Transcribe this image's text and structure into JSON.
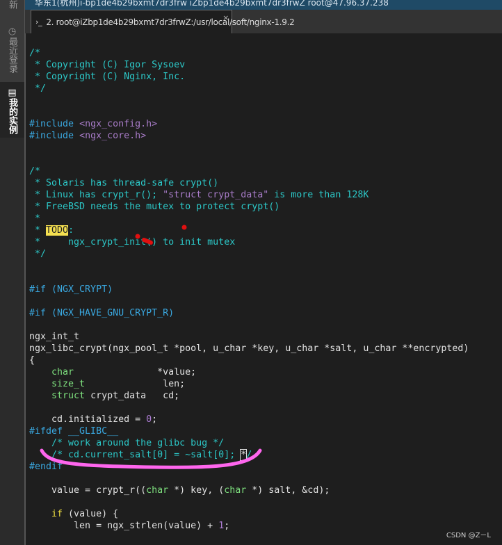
{
  "sidebar": {
    "items": [
      {
        "label": "新"
      },
      {
        "label": "最近登录",
        "icon": "clock-icon"
      },
      {
        "label": "我的实例",
        "icon": "list-icon",
        "selected": true
      }
    ]
  },
  "topbar": {
    "title": "华东1(杭州)i-bp1de4b29bxmt7dr3frw   iZbp1de4b29bxmt7dr3frwZ   root@47.96.37.238"
  },
  "tab": {
    "prompt": "›_",
    "label": "2. root@iZbp1de4b29bxmt7dr3frwZ:/usr/local/soft/nginx-1.9.2",
    "close": "×"
  },
  "colors": {
    "comment": "#2cc8c8",
    "preprocessor": "#3aa8e0",
    "string": "#a87cc8",
    "type": "#7ee07e",
    "keyword": "#f0e040",
    "number": "#b07fd8",
    "annotation": "#ff66ee",
    "dots": "#e01010"
  },
  "code": [
    [
      [
        "c",
        "/*"
      ]
    ],
    [
      [
        "c",
        " * Copyright (C) Igor Sysoev"
      ]
    ],
    [
      [
        "c",
        " * Copyright (C) Nginx, Inc."
      ]
    ],
    [
      [
        "c",
        " */"
      ]
    ],
    [],
    [],
    [
      [
        "p",
        "#include "
      ],
      [
        "s",
        "<ngx_config.h>"
      ]
    ],
    [
      [
        "p",
        "#include "
      ],
      [
        "s",
        "<ngx_core.h>"
      ]
    ],
    [],
    [],
    [
      [
        "c",
        "/*"
      ]
    ],
    [
      [
        "c",
        " * Solaris has thread-safe crypt()"
      ]
    ],
    [
      [
        "c",
        " * Linux has crypt_r(); "
      ],
      [
        "s",
        "\"struct crypt_data\""
      ],
      [
        "c",
        " is more than 128K"
      ]
    ],
    [
      [
        "c",
        " * FreeBSD needs the mutex to protect crypt()"
      ]
    ],
    [
      [
        "c",
        " *"
      ]
    ],
    [
      [
        "c",
        " * "
      ],
      [
        "todo",
        "TODO"
      ],
      [
        "c",
        ":"
      ]
    ],
    [
      [
        "c",
        " *     ngx_crypt_init() to init mutex"
      ]
    ],
    [
      [
        "c",
        " */"
      ]
    ],
    [],
    [],
    [
      [
        "p",
        "#if (NGX_CRYPT)"
      ]
    ],
    [],
    [
      [
        "p",
        "#if (NGX_HAVE_GNU_CRYPT_R)"
      ]
    ],
    [],
    [
      [
        "",
        "ngx_int_t"
      ]
    ],
    [
      [
        "",
        "ngx_libc_crypt(ngx_pool_t *pool, u_char *key, u_char *salt, u_char **encrypted)"
      ]
    ],
    [
      [
        "",
        "{"
      ]
    ],
    [
      [
        "",
        "    "
      ],
      [
        "t",
        "char"
      ],
      [
        "",
        "               *value;"
      ]
    ],
    [
      [
        "",
        "    "
      ],
      [
        "t",
        "size_t"
      ],
      [
        "",
        "              len;"
      ]
    ],
    [
      [
        "",
        "    "
      ],
      [
        "t",
        "struct"
      ],
      [
        "",
        " crypt_data   cd;"
      ]
    ],
    [],
    [
      [
        "",
        "    cd.initialized = "
      ],
      [
        "n",
        "0"
      ],
      [
        "",
        ";"
      ]
    ],
    [
      [
        "p",
        "#ifdef __GLIBC__"
      ]
    ],
    [
      [
        "c",
        "    /* work around the glibc bug */"
      ]
    ],
    [
      [
        "c",
        "    /* cd.current_salt[0] = ~salt[0]; "
      ],
      [
        "cursor",
        "*"
      ],
      [
        "c",
        "/"
      ]
    ],
    [
      [
        "p",
        "#endif"
      ]
    ],
    [],
    [
      [
        "",
        "    value = crypt_r(("
      ],
      [
        "t",
        "char"
      ],
      [
        "",
        " *) key, ("
      ],
      [
        "t",
        "char"
      ],
      [
        "",
        " *) salt, &cd);"
      ]
    ],
    [],
    [
      [
        "",
        "    "
      ],
      [
        "k",
        "if"
      ],
      [
        "",
        " (value) {"
      ]
    ],
    [
      [
        "",
        "        len = ngx_strlen(value) + "
      ],
      [
        "n",
        "1"
      ],
      [
        "",
        ";"
      ]
    ]
  ],
  "watermark": "CSDN @Z－L"
}
